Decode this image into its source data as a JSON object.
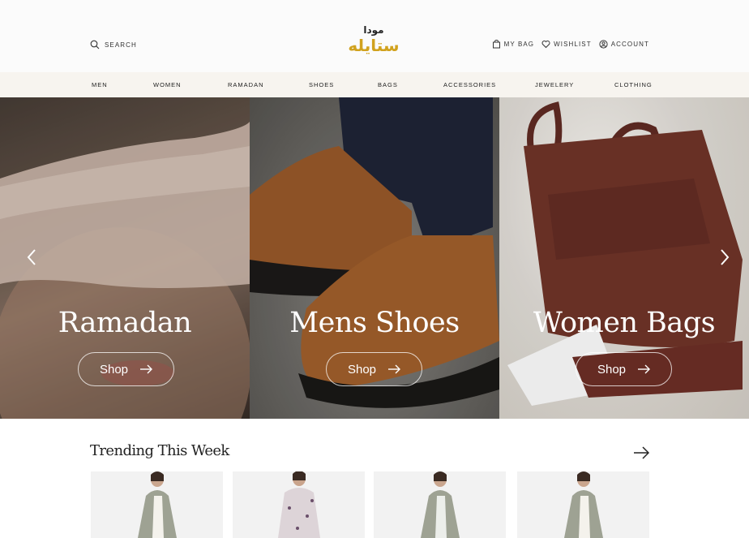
{
  "header": {
    "search_label": "SEARCH",
    "logo_top": "مودا",
    "logo_main": "ستايله",
    "bag_label": "MY BAG",
    "wishlist_label": "WISHLIST",
    "account_label": "ACCOUNT"
  },
  "nav": {
    "items": [
      "MEN",
      "WOMEN",
      "RAMADAN",
      "SHOES",
      "BAGS",
      "ACCESSORIES",
      "JEWELERY",
      "CLOTHING"
    ]
  },
  "hero": {
    "panels": [
      {
        "title": "Ramadan",
        "button": "Shop"
      },
      {
        "title": "Mens Shoes",
        "button": "Shop"
      },
      {
        "title": "Women Bags",
        "button": "Shop"
      }
    ]
  },
  "trending": {
    "title": "Trending This Week"
  },
  "colors": {
    "accent": "#d1a21e",
    "nav_bg": "#f7f4ef"
  }
}
